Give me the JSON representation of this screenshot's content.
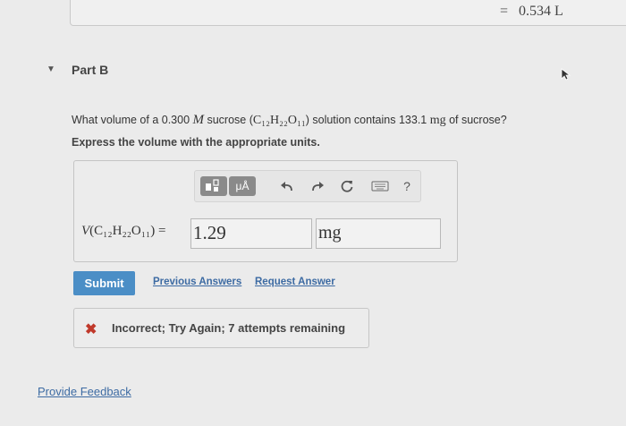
{
  "prev_answer": {
    "equals": "=",
    "value": "0.534 L"
  },
  "part": {
    "title": "Part B"
  },
  "question": {
    "prefix": "What volume of a 0.300 ",
    "var_M": "M",
    "mid": " sucrose (",
    "formula": "C₁₂H₂₂O₁₁",
    "suffix": ") solution contains 133.1 ",
    "unit_mg": "mg",
    "end": " of sucrose?"
  },
  "instruction": "Express the volume with the appropriate units.",
  "toolbar": {
    "units_label": "μÅ",
    "help_label": "?"
  },
  "answer": {
    "label_v": "V",
    "label_formula": "(C₁₂H₂₂O₁₁) =",
    "value": "1.29",
    "unit": "mg"
  },
  "actions": {
    "submit": "Submit",
    "previous_answers": "Previous Answers",
    "request_answer": "Request Answer"
  },
  "feedback": {
    "icon": "✖",
    "message": "Incorrect; Try Again; 7 attempts remaining"
  },
  "footer": {
    "provide_feedback": "Provide Feedback"
  }
}
